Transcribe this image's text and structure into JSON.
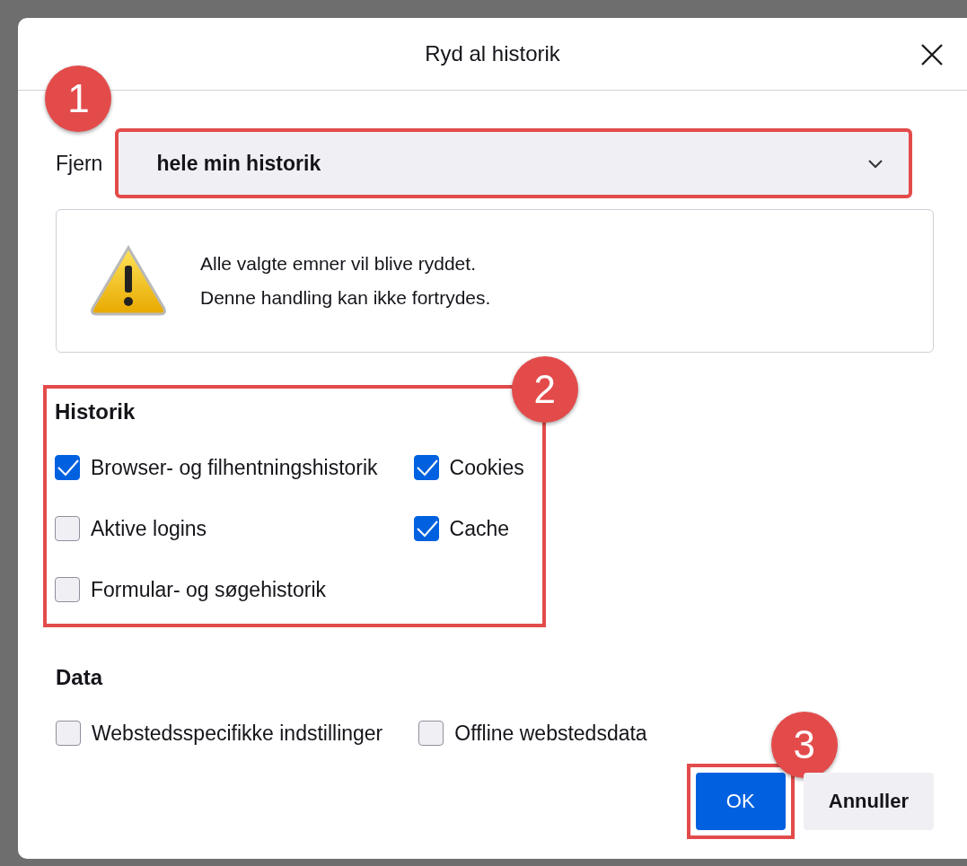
{
  "dialog": {
    "title": "Ryd al historik"
  },
  "range": {
    "label": "Fjern",
    "value": "hele min historik",
    "callout": "1"
  },
  "warning": {
    "lines": [
      "Alle valgte emner vil blive ryddet.",
      "Denne handling kan ikke fortrydes."
    ]
  },
  "sections": [
    {
      "title": "Historik",
      "callout": "2",
      "items": [
        {
          "label": "Browser- og filhentningshistorik",
          "checked": true
        },
        {
          "label": "Cookies",
          "checked": true
        },
        {
          "label": "Aktive logins",
          "checked": false
        },
        {
          "label": "Cache",
          "checked": true
        },
        {
          "label": "Formular- og søgehistorik",
          "checked": false
        }
      ]
    },
    {
      "title": "Data",
      "items": [
        {
          "label": "Webstedsspecifikke indstillinger",
          "checked": false
        },
        {
          "label": "Offline webstedsdata",
          "checked": false
        }
      ]
    }
  ],
  "buttons": [
    {
      "label": "OK",
      "kind": "primary",
      "callout": "3"
    },
    {
      "label": "Annuller",
      "kind": "secondary"
    }
  ]
}
